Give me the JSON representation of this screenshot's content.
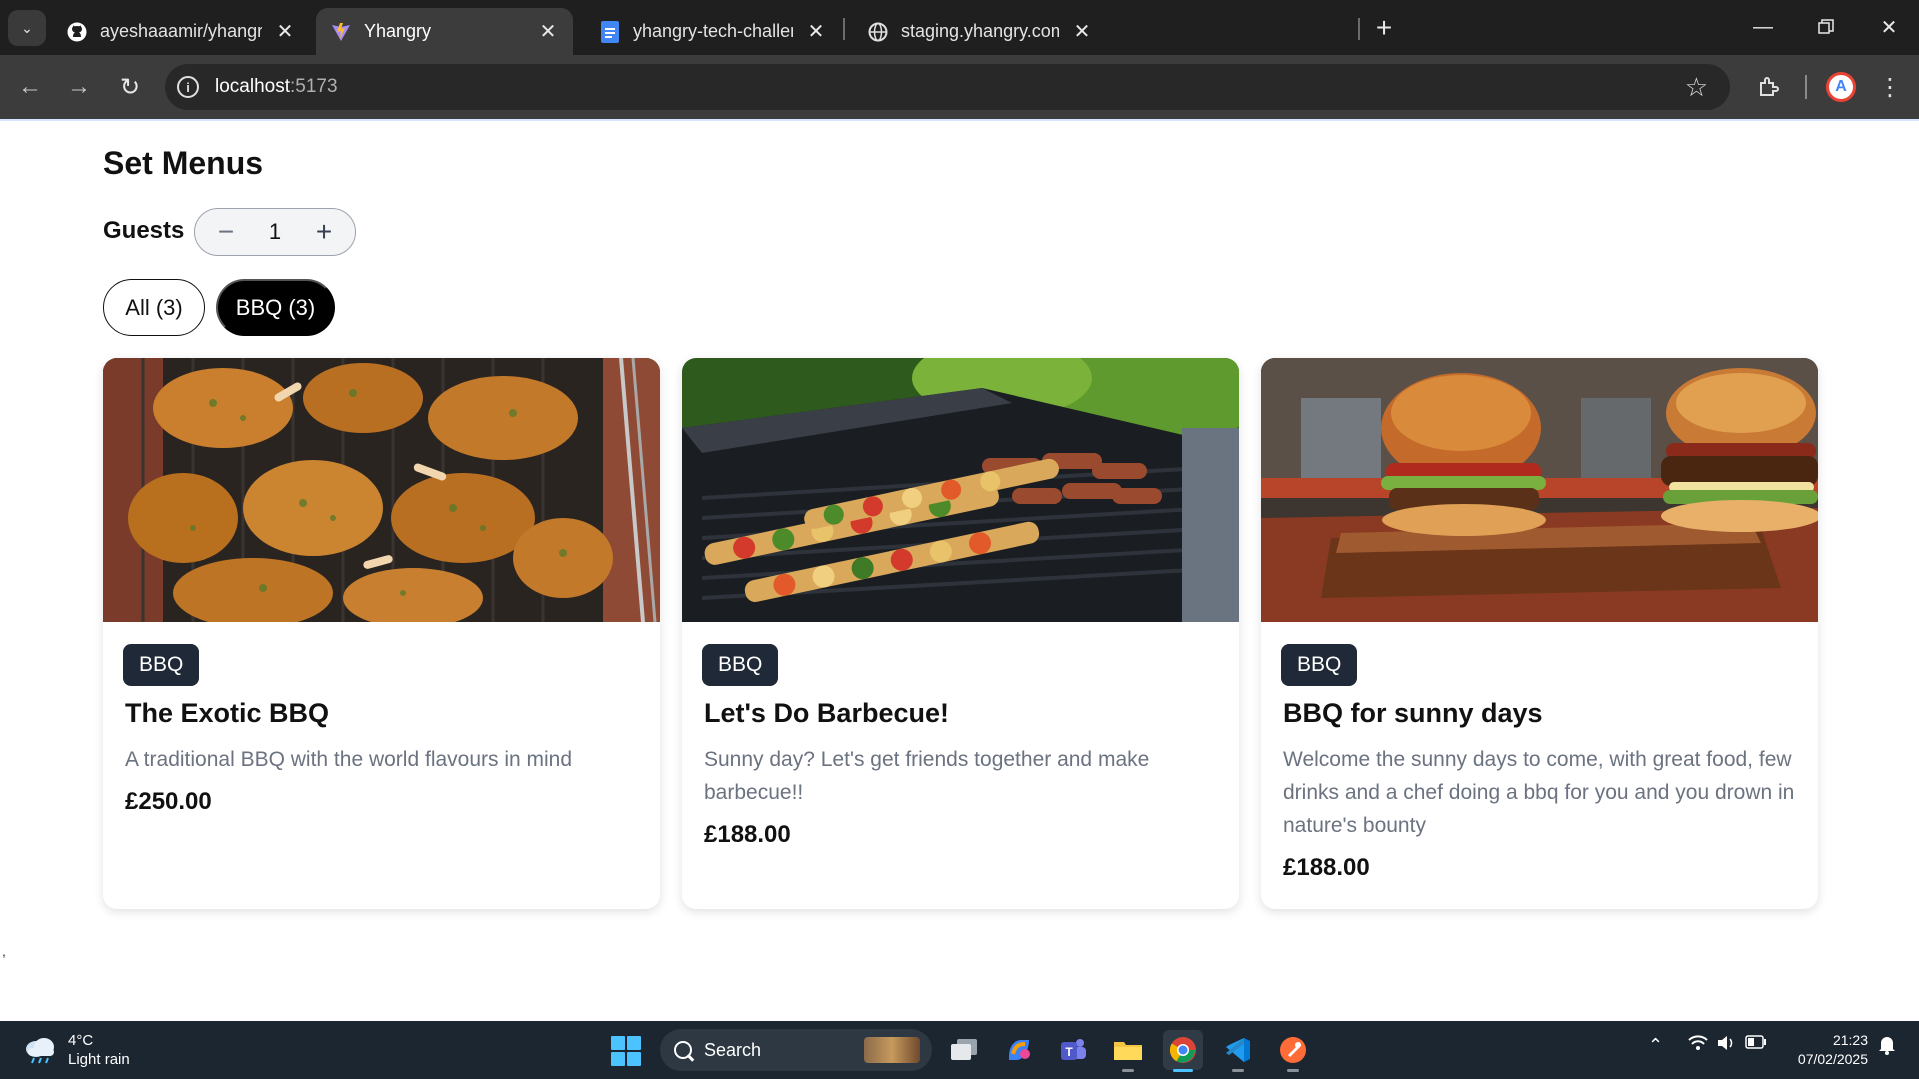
{
  "browser": {
    "tabs": [
      {
        "title": "ayeshaaamir/yhangry-test: Tech",
        "favicon": "github-icon",
        "active": false
      },
      {
        "title": "Yhangry",
        "favicon": "vite-icon",
        "active": true
      },
      {
        "title": "yhangry-tech-challenge - Goog",
        "favicon": "google-docs-icon",
        "active": false
      },
      {
        "title": "staging.yhangry.com/booking/t",
        "favicon": "globe-icon",
        "active": false
      }
    ],
    "close_glyph": "✕",
    "new_tab_glyph": "+",
    "url_host": "localhost",
    "url_port": ":5173"
  },
  "page": {
    "title": "Set Menus",
    "guests_label": "Guests",
    "guests_count": "1",
    "minus_glyph": "−",
    "plus_glyph": "+",
    "filters": [
      {
        "label": "All (3)",
        "selected": false
      },
      {
        "label": "BBQ (3)",
        "selected": true
      }
    ],
    "stray_text": ","
  },
  "cards": [
    {
      "badge": "BBQ",
      "title": "The Exotic BBQ",
      "description": "A traditional BBQ with the world flavours in mind",
      "price": "£250.00",
      "image": "grilled-lamb-chops"
    },
    {
      "badge": "BBQ",
      "title": "Let's Do Barbecue!",
      "description": "Sunny day? Let's get friends together and make barbecue!!",
      "price": "£188.00",
      "image": "skewers-and-sausages-on-grill"
    },
    {
      "badge": "BBQ",
      "title": "BBQ for sunny days",
      "description": "Welcome the sunny days to come, with great food, few drinks and a chef doing a bbq for you and you drown in nature's bounty",
      "price": "£188.00",
      "image": "burgers-on-wooden-board"
    }
  ],
  "taskbar": {
    "weather_temp": "4°C",
    "weather_desc": "Light rain",
    "search_placeholder": "Search",
    "time": "21:23",
    "date": "07/02/2025"
  },
  "colors": {
    "badge_bg": "#1f2937",
    "selected_pill": "#000000",
    "chrome_dark": "#1f1f1f",
    "taskbar_bg": "#1c2630"
  }
}
